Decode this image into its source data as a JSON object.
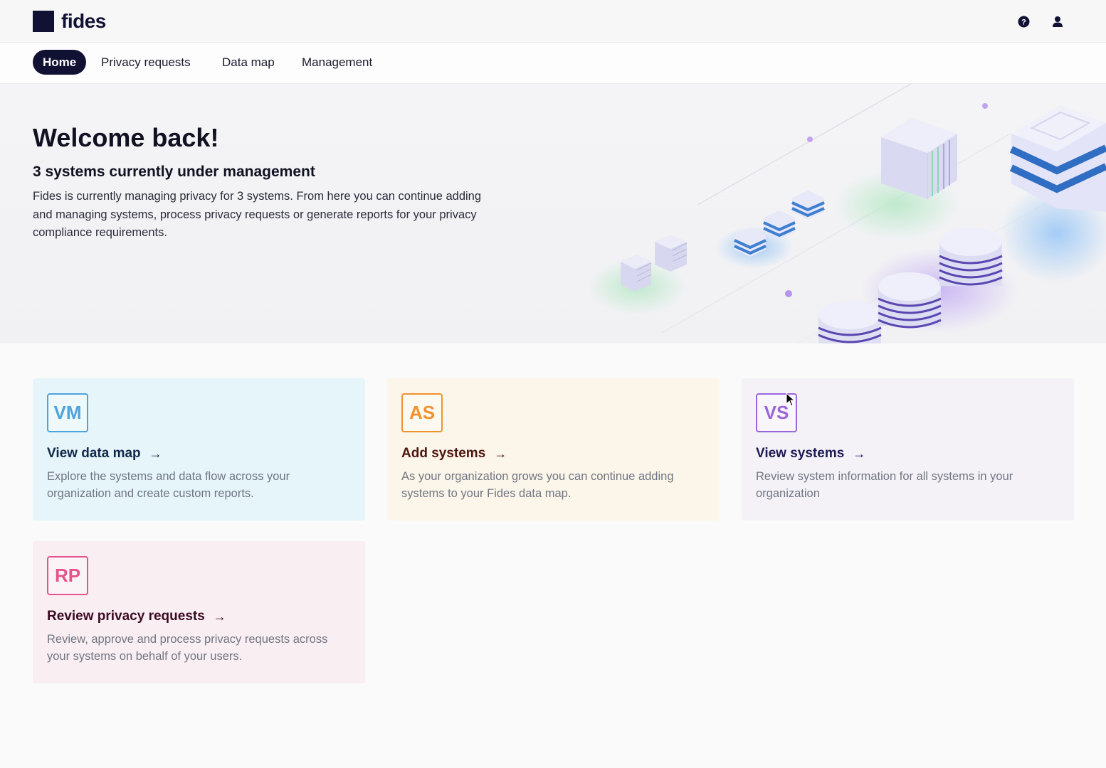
{
  "brand": {
    "name": "fides"
  },
  "header": {
    "icons": [
      "help-icon",
      "user-icon"
    ]
  },
  "nav": {
    "items": [
      {
        "label": "Home",
        "active": true
      },
      {
        "label": "Privacy requests",
        "active": false
      },
      {
        "label": "Data map",
        "active": false
      },
      {
        "label": "Management",
        "active": false
      }
    ]
  },
  "hero": {
    "title": "Welcome back!",
    "subtitle": "3 systems currently under management",
    "description": "Fides is currently managing privacy for 3 systems. From here you can continue adding and managing systems, process privacy requests or generate reports for your privacy compliance requirements."
  },
  "cards": [
    {
      "badge": "VM",
      "title": "View data map",
      "arrow": "→",
      "description": "Explore the systems and data flow across your organization and create custom reports.",
      "color": "#4da3dd"
    },
    {
      "badge": "AS",
      "title": "Add systems",
      "arrow": "→",
      "description": "As your organization grows you can continue adding systems to your Fides data map.",
      "color": "#f0922d"
    },
    {
      "badge": "VS",
      "title": "View systems",
      "arrow": "→",
      "description": "Review system information for all systems in your organization",
      "color": "#9966dd"
    },
    {
      "badge": "RP",
      "title": "Review privacy requests",
      "arrow": "→",
      "description": "Review, approve and process privacy requests across your systems on behalf of your users.",
      "color": "#e6528b"
    }
  ],
  "colors": {
    "brand_dark": "#111133",
    "background": "#fafafa"
  }
}
